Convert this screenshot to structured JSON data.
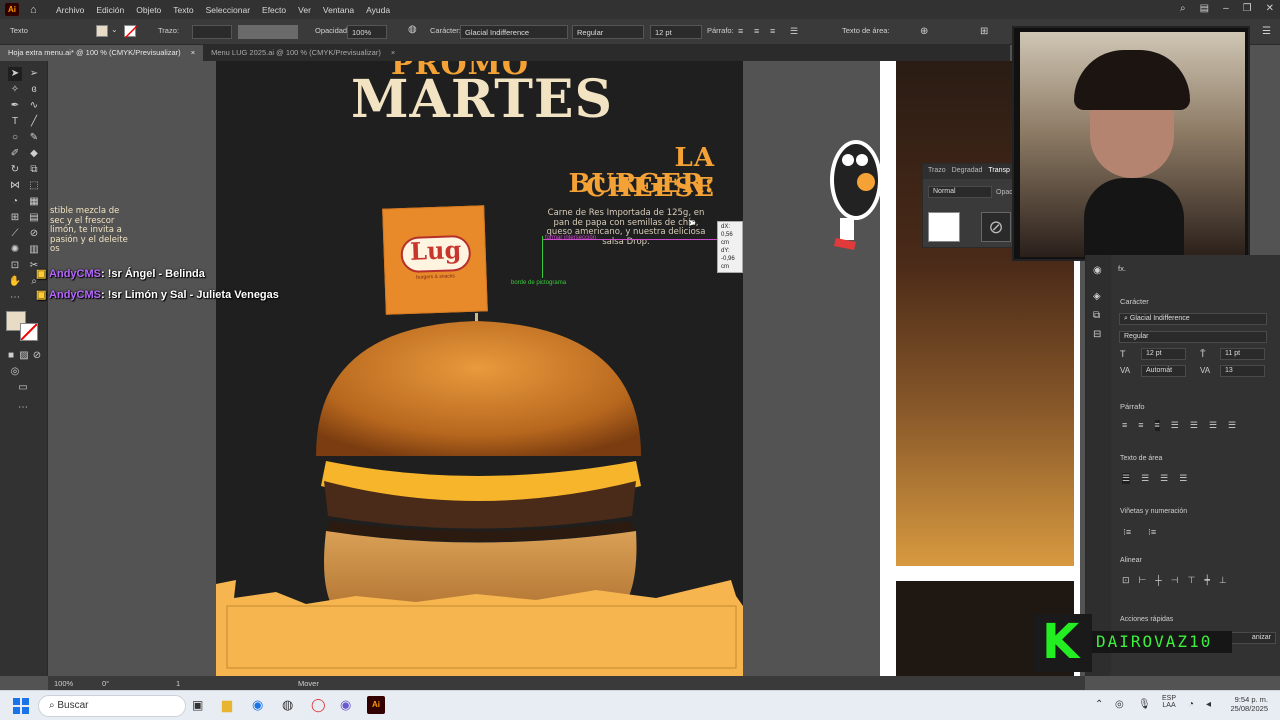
{
  "menubar": {
    "logo": "Ai",
    "items": [
      "Archivo",
      "Edición",
      "Objeto",
      "Texto",
      "Seleccionar",
      "Efecto",
      "Ver",
      "Ventana",
      "Ayuda"
    ]
  },
  "control_bar": {
    "selection": "Texto",
    "stroke_label": "Trazo:",
    "opacity_label": "Opacidad:",
    "opacity_value": "100%",
    "character_label": "Carácter:",
    "font": "Glacial Indifference",
    "style": "Regular",
    "size": "12 pt",
    "paragraph_label": "Párrafo:",
    "area_text_label": "Texto de área:"
  },
  "tabs": [
    {
      "label": "Hoja extra menu.ai* @ 100 % (CMYK/Previsualizar)",
      "close": "×"
    },
    {
      "label": "Menu LUG 2025.ai @ 100 % (CMYK/Previsualizar)",
      "close": "×"
    }
  ],
  "poster": {
    "title_top": "PROMO",
    "title": "MARTES",
    "heading_line1": "LA CHEESE",
    "heading_line2": "BURGER:",
    "description": [
      "Carne de Res Importada de 125g, en",
      "pan de papa con semillas de chía,",
      "queso americano, y nuestra deliciosa",
      "salsa Drop."
    ],
    "flag_logo": "Lug",
    "flag_sub": "burgers & snacks",
    "smart_guide_1": "borde de pictograma",
    "smart_guide_2": "formar intersección",
    "tooltip_dx": "dX: 0,56 cm",
    "tooltip_dy": "dY: -0,96 cm"
  },
  "left_text": [
    "stible mezcla de",
    "sec y el frescor",
    "limón, te invita a",
    "pasión y el deleite",
    "os"
  ],
  "chat": [
    {
      "user": "AndyCMS",
      "message": ": !sr Ángel - Belinda"
    },
    {
      "user": "AndyCMS",
      "message": ": !sr Limón y Sal - Julieta Venegas"
    }
  ],
  "float_panel": {
    "tabs": [
      "Trazo",
      "Degradad",
      "Transp"
    ],
    "mode": "Normal",
    "opacity_label": "Opac"
  },
  "right_panel": {
    "fx": "fx.",
    "character_title": "Carácter",
    "font": "Glacial Indifference",
    "style": "Regular",
    "size": "12 pt",
    "leading": "11 pt",
    "kerning": "Automát",
    "tracking": "13",
    "paragraph_title": "Párrafo",
    "area_text_title": "Texto de área",
    "bullets_title": "Viñetas y numeración",
    "align_title": "Alinear",
    "quick_actions_title": "Acciones rápidas",
    "organize_button": "anizar"
  },
  "statusbar": {
    "zoom": "100%",
    "rotation": "0°",
    "artboard_num": "1",
    "tool": "Mover"
  },
  "watermark": {
    "letter": "K",
    "name": "DAIROVAZ10"
  },
  "taskbar": {
    "search_placeholder": "Buscar",
    "lang1": "ESP",
    "lang2": "LAA",
    "time": "9:54 p. m.",
    "date": "25/08/2025"
  },
  "colors": {
    "accent_orange": "#f4a236",
    "poster_bg": "#1f1f1f",
    "cream": "#f2e3c3",
    "chat_user": "#b466ff"
  }
}
